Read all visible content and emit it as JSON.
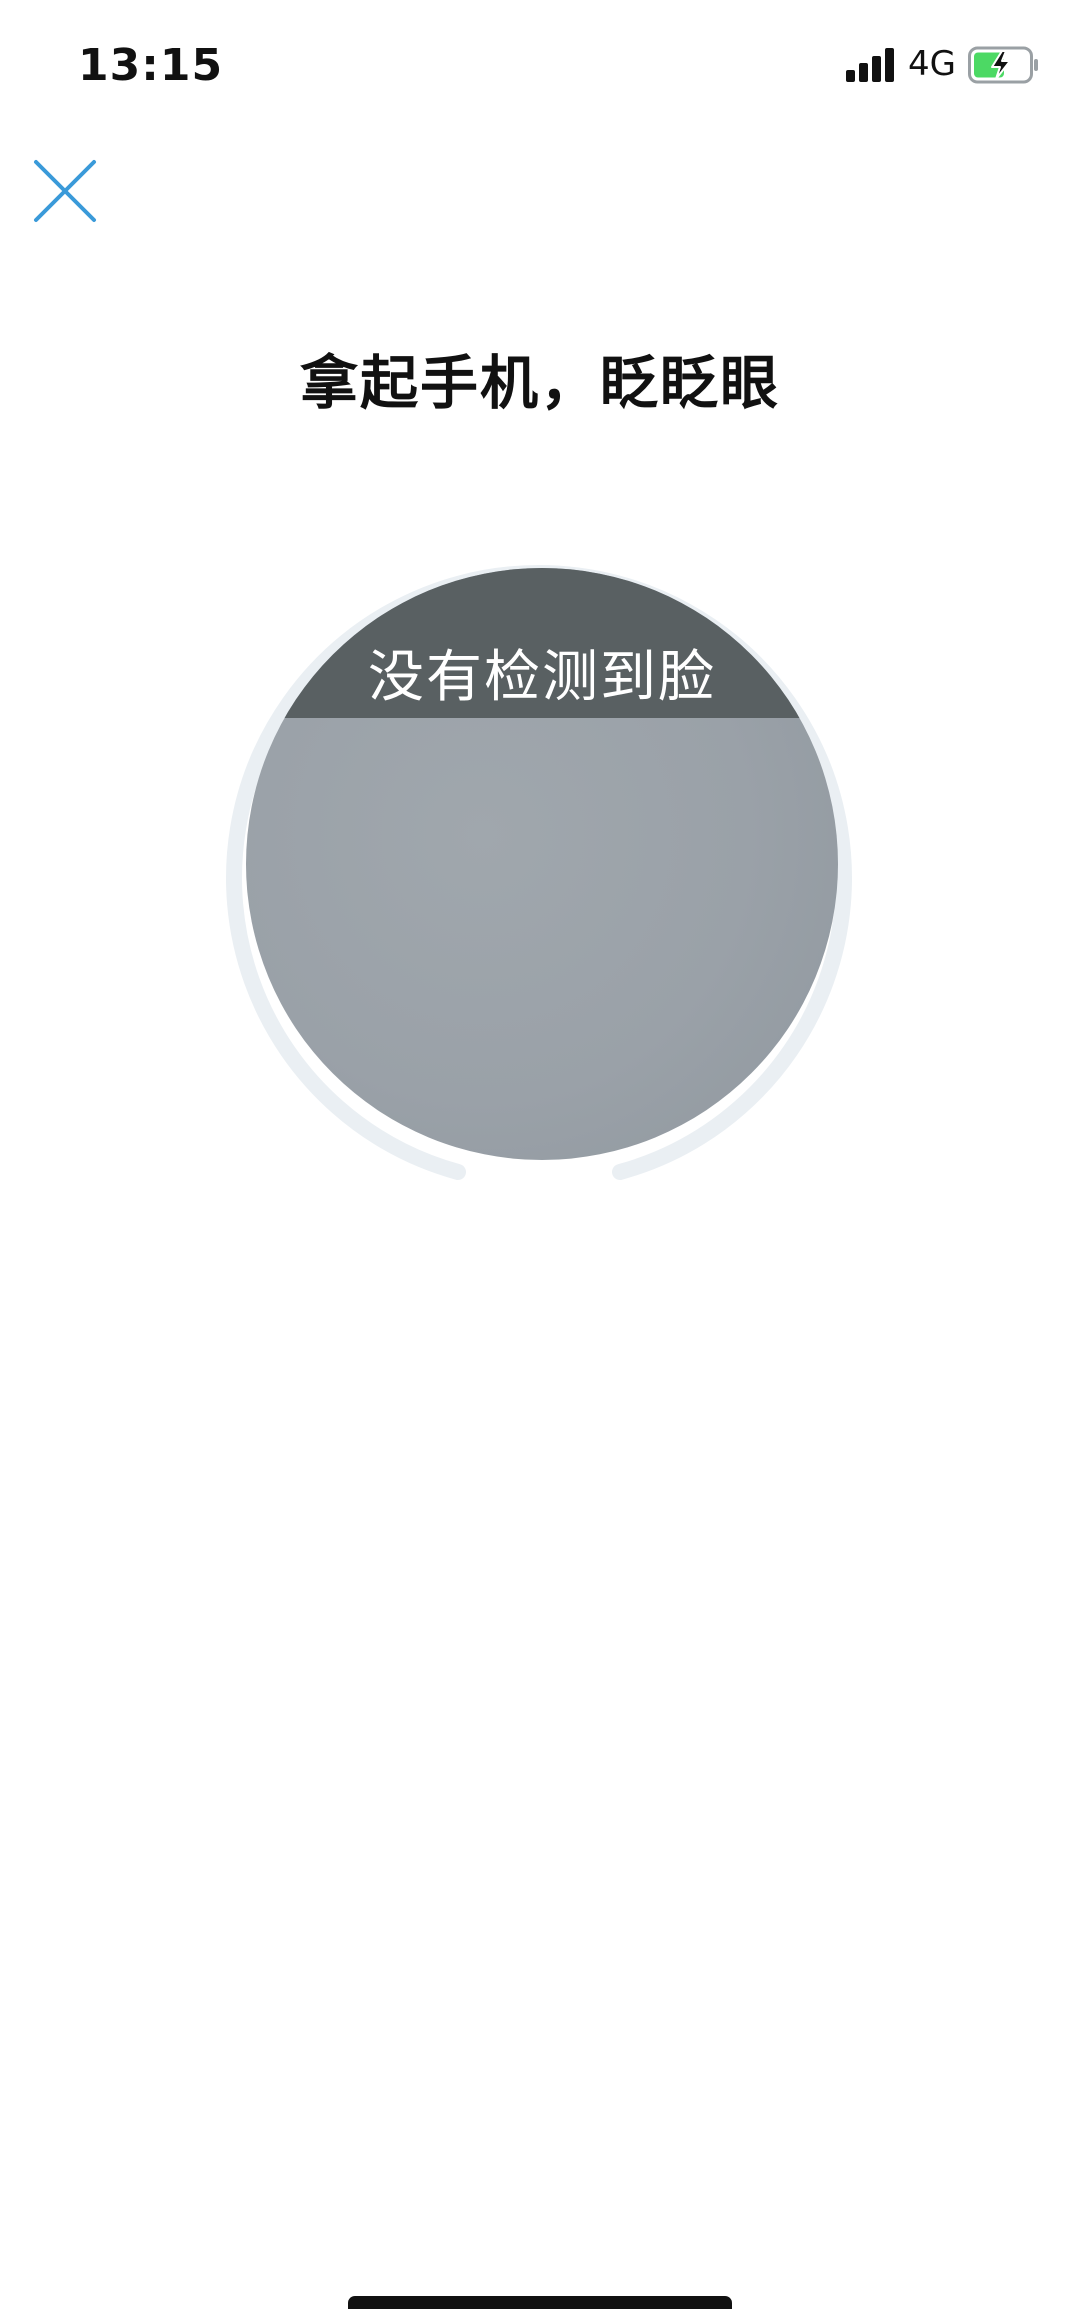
{
  "status_bar": {
    "time": "13:15",
    "network": "4G",
    "signal_icon": "cellular-signal-icon",
    "battery_icon": "battery-charging-icon",
    "battery_color": "#4cd964"
  },
  "header": {
    "close_icon": "close-icon",
    "close_color": "#3a9ad9"
  },
  "main": {
    "title": "拿起手机，眨眨眼",
    "camera_status": "没有检测到脸"
  }
}
